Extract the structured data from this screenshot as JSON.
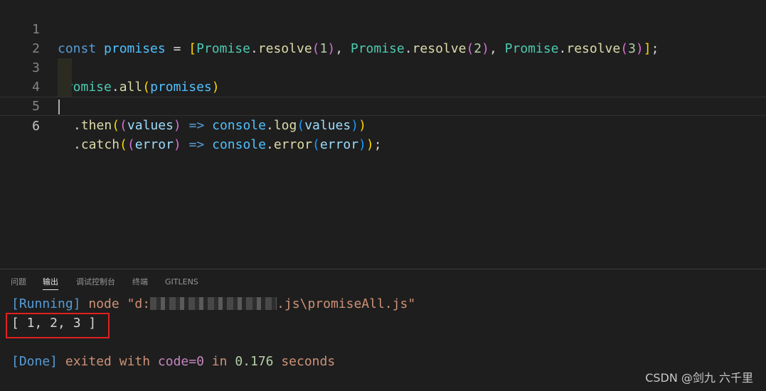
{
  "editor": {
    "line_numbers": [
      "1",
      "2",
      "3",
      "4",
      "5",
      "6"
    ],
    "line1": {
      "const": "const",
      "promises": "promises",
      "eq": " = ",
      "lbr": "[",
      "p1": "Promise",
      "dot1": ".",
      "r1": "resolve",
      "o1": "(",
      "n1": "1",
      "c1": ")",
      "comma1": ", ",
      "p2": "Promise",
      "dot2": ".",
      "r2": "resolve",
      "o2": "(",
      "n2": "2",
      "c2": ")",
      "comma2": ", ",
      "p3": "Promise",
      "dot3": ".",
      "r3": "resolve",
      "o3": "(",
      "n3": "3",
      "c3": ")",
      "rbr": "]",
      "semi": ";"
    },
    "line3": {
      "promise": "Promise",
      "dot": ".",
      "all": "all",
      "open": "(",
      "arg": "promises",
      "close": ")"
    },
    "line4": {
      "dot": ".",
      "then": "then",
      "open": "(",
      "popen": "(",
      "param": "values",
      "pclose": ")",
      "arrow": " => ",
      "console": "console",
      "dot2": ".",
      "log": "log",
      "copen": "(",
      "arg": "values",
      "cclose": ")",
      "close": ")"
    },
    "line5": {
      "dot": ".",
      "catch": "catch",
      "open": "(",
      "popen": "(",
      "param": "error",
      "pclose": ")",
      "arrow": " => ",
      "console": "console",
      "dot2": ".",
      "error": "error",
      "copen": "(",
      "arg": "error",
      "cclose": ")",
      "close": ")",
      "semi": ";"
    }
  },
  "panel": {
    "tabs": [
      {
        "label": "问题"
      },
      {
        "label": "输出",
        "active": true
      },
      {
        "label": "调试控制台"
      },
      {
        "label": "终端"
      },
      {
        "label": "GITLENS"
      }
    ],
    "output": {
      "running": "[Running]",
      "node_cmd": " node \"d:",
      "path_tail": ".js\\promiseAll.js\"",
      "result": "[ 1, 2, 3 ]",
      "done": "[Done]",
      "exited_with": " exited with ",
      "code_eq": "code=0",
      "in": " in ",
      "seconds_value": "0.176",
      "seconds": " seconds"
    }
  },
  "watermark": "CSDN @剑九 六千里",
  "colors": {
    "background": "#1e1e1e",
    "highlight_box": "#e02020"
  }
}
